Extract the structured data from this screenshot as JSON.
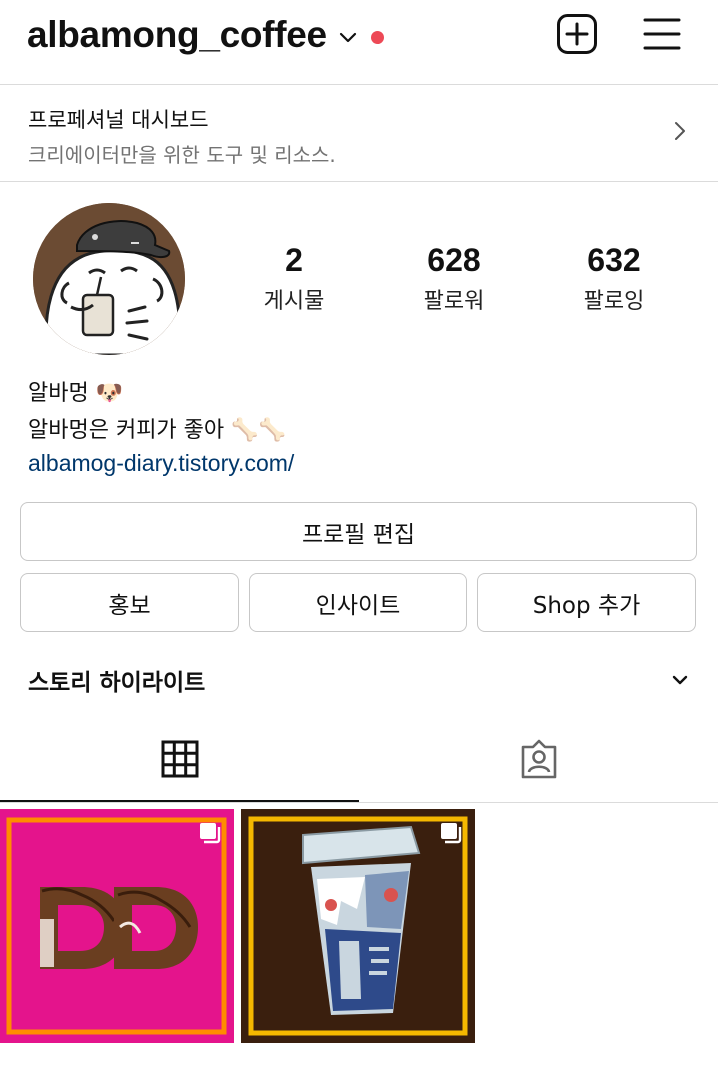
{
  "header": {
    "username": "albamong_coffee",
    "icons": {
      "dropdown": "chevron-down-icon",
      "notification": "red-dot",
      "create": "plus-square-icon",
      "menu": "hamburger-menu-icon"
    },
    "dot_color": "#ed4956"
  },
  "dashboard": {
    "title": "프로페셔널 대시보드",
    "subtitle": "크리에이터만을 위한 도구 및 리소스.",
    "arrow_icon": "chevron-right-icon"
  },
  "profile": {
    "stats": [
      {
        "value": "2",
        "label": "게시물"
      },
      {
        "value": "628",
        "label": "팔로워"
      },
      {
        "value": "632",
        "label": "팔로잉"
      }
    ],
    "name": "알바멍 🐶",
    "bio": "알바멍은 커피가 좋아 🦴🦴",
    "link": "albamog-diary.tistory.com/"
  },
  "buttons": {
    "edit_profile": "프로필 편집",
    "promote": "홍보",
    "insights": "인사이트",
    "add_shop": "Shop 추가"
  },
  "highlights": {
    "label": "스토리 하이라이트",
    "toggle_icon": "chevron-down-icon"
  },
  "tabs": [
    {
      "icon": "grid-icon",
      "active": true
    },
    {
      "icon": "tagged-person-icon",
      "active": false
    }
  ],
  "posts": [
    {
      "image": "donut-dd-logo",
      "multi_icon": "carousel-icon",
      "letters": "DD"
    },
    {
      "image": "mega-coffee-cup",
      "multi_icon": "carousel-icon",
      "cup_text": "MEGA COFFEE"
    }
  ],
  "colors": {
    "link": "#00376b",
    "post1_bg": "#e4148c",
    "post1_frame": "#ff8c00",
    "post2_bg": "#3a1f0e",
    "post2_frame": "#f5b800"
  }
}
